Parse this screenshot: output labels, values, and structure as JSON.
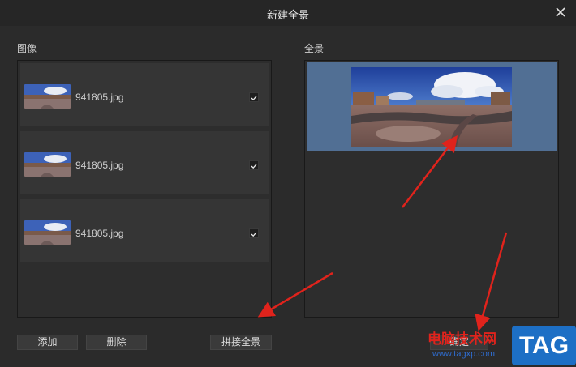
{
  "window": {
    "title": "新建全景"
  },
  "images_section": {
    "label": "图像",
    "items": [
      {
        "filename": "941805.jpg",
        "checked": true
      },
      {
        "filename": "941805.jpg",
        "checked": true
      },
      {
        "filename": "941805.jpg",
        "checked": true
      }
    ]
  },
  "panorama_section": {
    "label": "全景"
  },
  "buttons": {
    "add": "添加",
    "delete": "删除",
    "stitch": "拼接全景",
    "ok": "确定"
  },
  "watermark": {
    "site_name": "电脑技术网",
    "url": "www.tagxp.com",
    "tag": "TAG"
  },
  "colors": {
    "background": "#2b2b2b",
    "selection": "#516f94",
    "annotation_arrow": "#e0231c",
    "watermark_red": "#e0231c",
    "watermark_blue": "#1d6fc5"
  }
}
